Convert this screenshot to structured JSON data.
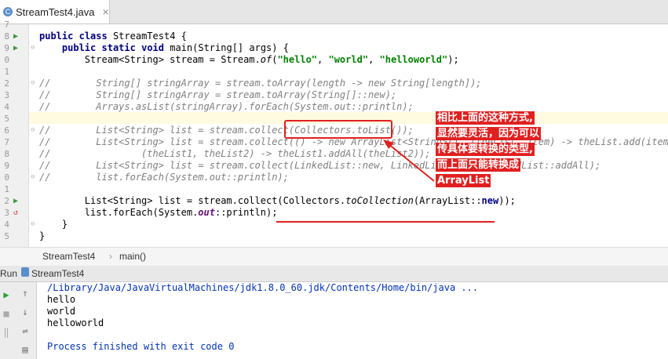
{
  "tab": {
    "filename": "StreamTest4.java",
    "file_icon_letter": "C",
    "close_glyph": "×"
  },
  "lines": [
    {
      "num": "7",
      "code": ""
    },
    {
      "num": "8",
      "code": "public class StreamTest4 {"
    },
    {
      "num": "9",
      "code": "    public static void main(String[] args) {"
    },
    {
      "num": "0",
      "code": "        Stream<String> stream = Stream.of(\"hello\", \"world\", \"helloworld\");"
    },
    {
      "num": "1",
      "code": ""
    },
    {
      "num": "2",
      "code": "//        String[] stringArray = stream.toArray(length -> new String[length]);"
    },
    {
      "num": "3",
      "code": "//        String[] stringArray = stream.toArray(String[]::new);"
    },
    {
      "num": "4",
      "code": "//        Arrays.asList(stringArray).forEach(System.out::println);"
    },
    {
      "num": "5",
      "code": ""
    },
    {
      "num": "6",
      "code": "//        List<String> list = stream.collect(Collectors.toList());"
    },
    {
      "num": "7",
      "code": "//        List<String> list = stream.collect(() -> new ArrayList<String>(), (theList, item) -> theList.add(item),"
    },
    {
      "num": "8",
      "code": "//                (theList1, theList2) -> theList1.addAll(theList2));"
    },
    {
      "num": "9",
      "code": "//        List<String> list = stream.collect(LinkedList::new, LinkedList::add, LinkedList::addAll);"
    },
    {
      "num": "0",
      "code": "//        list.forEach(System.out::println);"
    },
    {
      "num": "1",
      "code": ""
    },
    {
      "num": "2",
      "code": "        List<String> list = stream.collect(Collectors.toCollection(ArrayList::new));"
    },
    {
      "num": "3",
      "code": "        list.forEach(System.out::println);"
    },
    {
      "num": "4",
      "code": "    }"
    },
    {
      "num": "5",
      "code": "}"
    }
  ],
  "breadcrumb": {
    "class": "StreamTest4",
    "sep": "›",
    "method": "main()"
  },
  "run": {
    "label": "Run",
    "config": "StreamTest4"
  },
  "console": {
    "path": "/Library/Java/JavaVirtualMachines/jdk1.8.0_60.jdk/Contents/Home/bin/java ...",
    "output": [
      "hello",
      "world",
      "helloworld"
    ],
    "exit": "Process finished with exit code 0"
  },
  "annotation": {
    "lines": [
      "相比上面的这种方式,",
      "显然要灵活，因为可以",
      "传具体要转换的类型,",
      "而上面只能转换成",
      "ArrayList"
    ],
    "color": "#e02020"
  }
}
